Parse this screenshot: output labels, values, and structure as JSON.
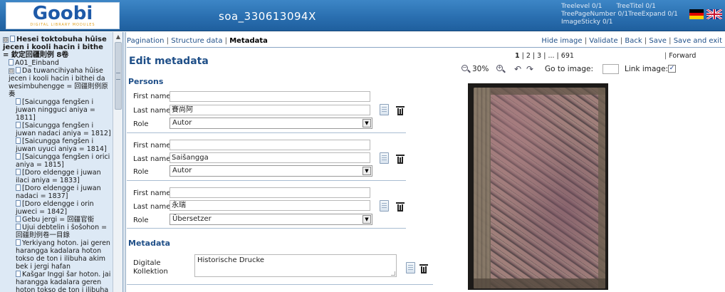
{
  "header": {
    "logo_text": "Goobi",
    "logo_subtext": "DIGITAL LIBRARY MODULES",
    "document_title": "soa_330613094X",
    "status": {
      "treelevel": "Treelevel 0/1",
      "treetitel": "TreeTitel 0/1",
      "treepagenumber": "TreePageNumber 0/1",
      "treeexpand": "TreeExpand 0/1",
      "imagesticky": "ImageSticky 0/1"
    },
    "flags": [
      "german-flag-icon",
      "uk-flag-icon"
    ]
  },
  "tree": {
    "items": [
      {
        "toggle": "⊟",
        "icon": "document-icon",
        "label": "Hesei toktobuha hûise jecen i kooli hacin i bithe = 欽定回疆則例 8卷",
        "bold": true
      },
      {
        "icon": "document-icon",
        "label": "A01_Einband"
      },
      {
        "toggle": "⊟",
        "icon": "document-icon",
        "label": "Da tuwancihiyaha hûise jecen i kooli hacin i bithei da wesimbuhengge = 回疆則例原奏"
      },
      {
        "icon": "document-icon",
        "label": "[Saicungga fengšen i juwan ningguci aniya = 1811]"
      },
      {
        "icon": "document-icon",
        "label": "[Saicungga fengšen i juwan nadaci aniya = 1812]"
      },
      {
        "icon": "document-icon",
        "label": "[Saicungga fengšen i juwan uyuci aniya = 1814]"
      },
      {
        "icon": "document-icon",
        "label": "[Saicungga fengšen i orici aniya = 1815]"
      },
      {
        "icon": "document-icon",
        "label": "[Doro eldengge i juwan ilaci aniya = 1833]"
      },
      {
        "icon": "document-icon",
        "label": "[Doro eldengge i juwan nadaci = 1837]"
      },
      {
        "icon": "document-icon",
        "label": "[Doro eldengge i orin juweci = 1842]"
      },
      {
        "icon": "document-icon",
        "label": "Gebu jergi = 回疆官銜"
      },
      {
        "icon": "document-icon",
        "label": "Ujui debtelin i šošohon = 回疆則例卷一目錄"
      },
      {
        "icon": "document-icon",
        "label": "Yerkiyang hoton. jai geren harangga kadalara hoton tokso de ton i ilibuha akim bek i jergi hafan"
      },
      {
        "icon": "document-icon",
        "label": "Kašgar Inggi šar hoton. jai harangga kadalara geren hoton tokso de ton i ilibuha akim bek i jergi hafan"
      }
    ]
  },
  "nav": {
    "left": [
      "Pagination",
      "Structure data",
      "Metadata"
    ],
    "current": "Metadata",
    "right": [
      "Hide image",
      "Validate",
      "Back",
      "Save",
      "Save and exit"
    ]
  },
  "edit": {
    "title": "Edit metadata",
    "persons_heading": "Persons",
    "first_name_label": "First name",
    "last_name_label": "Last name",
    "role_label": "Role",
    "persons": [
      {
        "first_name": "",
        "last_name": "賽尚阿",
        "role": "Autor"
      },
      {
        "first_name": "",
        "last_name": "Saišangga",
        "role": "Autor"
      },
      {
        "first_name": "",
        "last_name": "永瑞",
        "role": "Übersetzer"
      }
    ],
    "metadata_heading": "Metadata",
    "metadata": [
      {
        "label": "Digitale Kollektion",
        "value": "Historische Drucke"
      }
    ]
  },
  "image_panel": {
    "pages": [
      "1",
      "2",
      "3",
      "...",
      "691"
    ],
    "current_page": "1",
    "forward": "Forward",
    "zoom": "30%",
    "goto_label": "Go to image:",
    "goto_value": "",
    "link_image_label": "Link image:",
    "link_image_checked": true,
    "check_mark": "✓"
  }
}
